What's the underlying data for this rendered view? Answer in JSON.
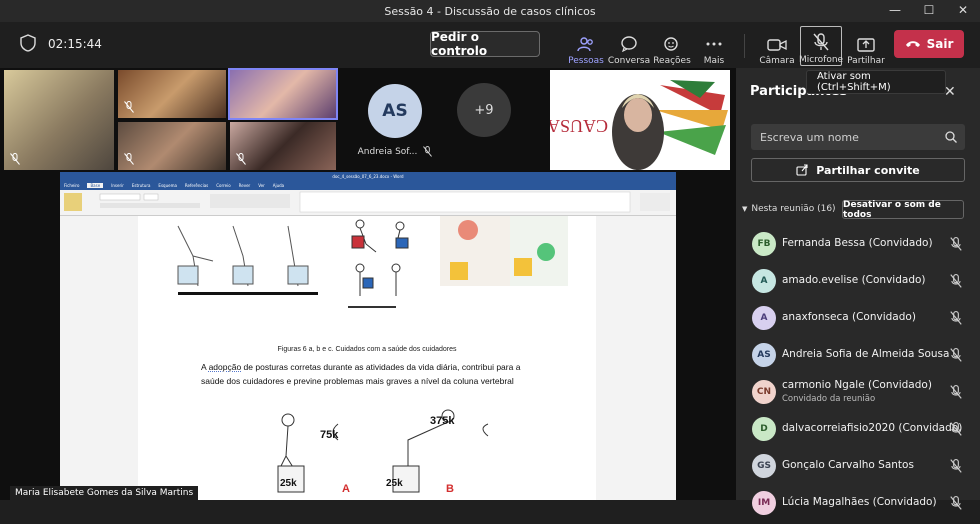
{
  "window": {
    "title": "Sessão 4 - Discussão de casos clínicos",
    "controls": [
      "—",
      "☐",
      "✕"
    ]
  },
  "toolbar": {
    "timer": "02:15:44",
    "request_control": "Pedir o controlo",
    "people": "Pessoas",
    "chat": "Conversa",
    "reactions": "Reações",
    "more": "Mais",
    "camera": "Câmara",
    "microphone": "Microfone",
    "share": "Partilhar",
    "leave": "Sair"
  },
  "tooltip": "Ativar som (Ctrl+Shift+M)",
  "stage": {
    "avatar_initials": "AS",
    "avatar_name": "Andreia Sof...",
    "overflow_count": "+9",
    "presenter_name": "Maria Elisabete Gomes da Silva Martins",
    "banner_text": "CAUSA MAIOR"
  },
  "shared_doc": {
    "word_title": "doc_4_sessão_07_6_23.docx - Word",
    "tabs": [
      "Ficheiro",
      "Base",
      "Inserir",
      "Estrutura",
      "Esquema",
      "Referências",
      "Correio",
      "Rever",
      "Ver",
      "Ajuda"
    ],
    "caption": "Figuras 6 a, b e c. Cuidados com a saúde dos cuidadores",
    "paragraph_start": "A ",
    "paragraph_word": "adopção",
    "paragraph_rest": " de posturas corretas durante as atividades da vida diária, contribui para a saúde dos cuidadores e previne problemas mais graves a nível da coluna vertebral",
    "figure_labels": {
      "weight_a": "75k",
      "weight_b": "375k",
      "box_a": "25k",
      "box_b": "25k",
      "letter_a": "A",
      "letter_b": "B"
    }
  },
  "panel": {
    "title": "Participantes",
    "search_placeholder": "Escreva um nome",
    "invite": "Partilhar convite",
    "in_meeting": "Nesta reunião (16)",
    "mute_all": "Desativar o som de todos",
    "participants": [
      {
        "initials": "FB",
        "name": "Fernanda Bessa (Convidado)",
        "sub": "",
        "color": "#c9e8c6",
        "fg": "#2b5d2b"
      },
      {
        "initials": "A",
        "name": "amado.evelise (Convidado)",
        "sub": "",
        "color": "#c6e6e2",
        "fg": "#215955"
      },
      {
        "initials": "A",
        "name": "anaxfonseca (Convidado)",
        "sub": "",
        "color": "#d8d0ef",
        "fg": "#4a3c7a"
      },
      {
        "initials": "AS",
        "name": "Andreia Sofia de Almeida Sousa",
        "sub": "",
        "color": "#c5d3e8",
        "fg": "#243a5e"
      },
      {
        "initials": "CN",
        "name": "carmonio Ngale (Convidado)",
        "sub": "Convidado da reunião",
        "color": "#f0d3cc",
        "fg": "#7a3a2b"
      },
      {
        "initials": "D",
        "name": "dalvacorreiafisio2020 (Convidado)",
        "sub": "",
        "color": "#c9e8c6",
        "fg": "#2b5d2b"
      },
      {
        "initials": "GS",
        "name": "Gonçalo Carvalho Santos",
        "sub": "",
        "color": "#d0d5dd",
        "fg": "#3a4252"
      },
      {
        "initials": "IM",
        "name": "Lúcia Magalhães (Convidado)",
        "sub": "",
        "color": "#f0cfe0",
        "fg": "#7a2b55"
      }
    ]
  }
}
